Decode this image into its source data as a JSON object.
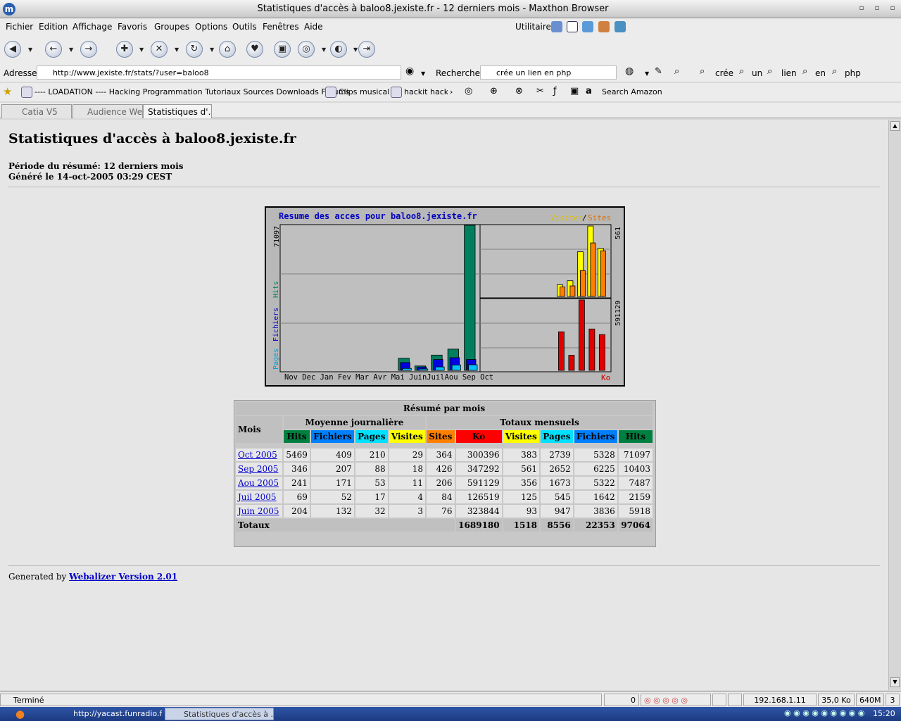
{
  "window": {
    "title": "Statistiques d'accès à baloo8.jexiste.fr - 12 derniers mois - Maxthon Browser"
  },
  "menu": [
    "Fichier",
    "Edition",
    "Affichage",
    "Favoris",
    "Groupes",
    "Options",
    "Outils",
    "Fenêtres",
    "Aide"
  ],
  "menu_utilities": "Utilitaires",
  "address": {
    "label": "Adresse",
    "url": "http://www.jexiste.fr/stats/?user=baloo8"
  },
  "search": {
    "label": "Rechercher",
    "query": "crée un lien en php",
    "terms": [
      "crée",
      "un",
      "lien",
      "en",
      "php"
    ]
  },
  "favorites": [
    "---- LOADATION ---- Hacking Programmation Tutoriaux Sources Downloads Forums",
    "Clips musical",
    "hackit hackit",
    "Search Amazon"
  ],
  "tabs": [
    "Catia V5",
    "Audience We...",
    "Statistiques d'..."
  ],
  "page": {
    "title": "Statistiques d'accès à baloo8.jexiste.fr",
    "period": "Période du résumé: 12 derniers mois",
    "generated": "Généré le 14-oct-2005 03:29 CEST"
  },
  "graph": {
    "title": "Resume des acces pour baloo8.jexiste.fr",
    "legend_right_visites": "Visites",
    "legend_sep": "/",
    "legend_right_sites": "Sites",
    "y_left_pages": "Pages",
    "y_left_fichiers": "Fichiers",
    "y_left_hits": "Hits",
    "y_left_max": "71097",
    "y_right_top_max": "561",
    "y_right_bottom_max": "591129",
    "ko_label": "Ko",
    "months_label": "Nov Dec Jan Fev Mar Avr Mai JuinJuilAou Sep Oct",
    "colors": {
      "hits": "#007f5f",
      "fichiers": "#0000e0",
      "pages": "#00c0ff",
      "visites": "#ffff00",
      "sites": "#ff8000",
      "ko": "#e00000"
    }
  },
  "chart_data": {
    "type": "bar",
    "title": "Resume des acces pour baloo8.jexiste.fr",
    "categories": [
      "Nov",
      "Dec",
      "Jan",
      "Fev",
      "Mar",
      "Avr",
      "Mai",
      "Juin",
      "Juil",
      "Aou",
      "Sep",
      "Oct"
    ],
    "series": [
      {
        "name": "Hits",
        "values": [
          0,
          0,
          0,
          0,
          0,
          0,
          0,
          5918,
          2159,
          7487,
          10403,
          71097
        ]
      },
      {
        "name": "Fichiers",
        "values": [
          0,
          0,
          0,
          0,
          0,
          0,
          0,
          3836,
          1642,
          5322,
          6225,
          5328
        ]
      },
      {
        "name": "Pages",
        "values": [
          0,
          0,
          0,
          0,
          0,
          0,
          0,
          947,
          545,
          1673,
          2652,
          2739
        ]
      },
      {
        "name": "Visites",
        "values": [
          0,
          0,
          0,
          0,
          0,
          0,
          0,
          93,
          125,
          356,
          561,
          383
        ]
      },
      {
        "name": "Sites",
        "values": [
          0,
          0,
          0,
          0,
          0,
          0,
          0,
          76,
          84,
          206,
          426,
          364
        ]
      },
      {
        "name": "Ko",
        "values": [
          0,
          0,
          0,
          0,
          0,
          0,
          0,
          323844,
          126519,
          591129,
          347292,
          300396
        ]
      }
    ],
    "ylim_hits": [
      0,
      71097
    ],
    "ylim_visites": [
      0,
      561
    ],
    "ylim_ko": [
      0,
      591129
    ]
  },
  "summary": {
    "caption": "Résumé par mois",
    "col_mois": "Mois",
    "group_daily": "Moyenne journalière",
    "group_monthly": "Totaux mensuels",
    "headers": [
      "Hits",
      "Fichiers",
      "Pages",
      "Visites",
      "Sites",
      "Ko",
      "Visites",
      "Pages",
      "Fichiers",
      "Hits"
    ],
    "header_colors": [
      "#008040",
      "#0080ff",
      "#00e0ff",
      "#ffff00",
      "#ff8000",
      "#ff0000",
      "#ffff00",
      "#00e0ff",
      "#0080ff",
      "#008040"
    ],
    "rows": [
      {
        "month": "Oct 2005",
        "vals": [
          "5469",
          "409",
          "210",
          "29",
          "364",
          "300396",
          "383",
          "2739",
          "5328",
          "71097"
        ]
      },
      {
        "month": "Sep 2005",
        "vals": [
          "346",
          "207",
          "88",
          "18",
          "426",
          "347292",
          "561",
          "2652",
          "6225",
          "10403"
        ]
      },
      {
        "month": "Aou 2005",
        "vals": [
          "241",
          "171",
          "53",
          "11",
          "206",
          "591129",
          "356",
          "1673",
          "5322",
          "7487"
        ]
      },
      {
        "month": "Juil 2005",
        "vals": [
          "69",
          "52",
          "17",
          "4",
          "84",
          "126519",
          "125",
          "545",
          "1642",
          "2159"
        ]
      },
      {
        "month": "Juin 2005",
        "vals": [
          "204",
          "132",
          "32",
          "3",
          "76",
          "323844",
          "93",
          "947",
          "3836",
          "5918"
        ]
      }
    ],
    "totals_label": "Totaux",
    "totals": [
      "1689180",
      "1518",
      "8556",
      "22353",
      "97064"
    ]
  },
  "footer": {
    "prefix": "Generated by",
    "link": "Webalizer Version 2.01"
  },
  "status": {
    "text": "Terminé",
    "counter": "0",
    "ip": "192.168.1.11",
    "size": "35,0 Ko",
    "mem": "640M",
    "num": "3"
  },
  "taskbar": {
    "tasks": [
      "http://yacast.funradio.f...",
      "Statistiques d'accès à ..."
    ],
    "clock": "15:20"
  }
}
